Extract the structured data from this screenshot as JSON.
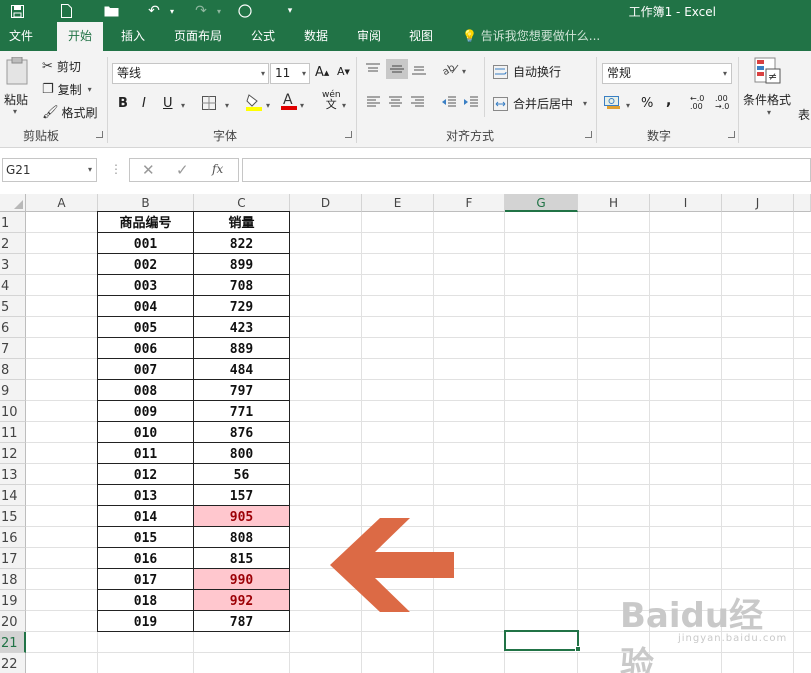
{
  "window": {
    "title": "工作簿1 - Excel"
  },
  "tabs": [
    "文件",
    "开始",
    "插入",
    "页面布局",
    "公式",
    "数据",
    "审阅",
    "视图"
  ],
  "tell_me": "告诉我您想要做什么...",
  "ribbon": {
    "clipboard": {
      "paste": "粘贴",
      "cut": "剪切",
      "copy": "复制",
      "format_painter": "格式刷",
      "label": "剪贴板"
    },
    "font": {
      "name": "等线",
      "size": "11",
      "label": "字体",
      "bold": "B",
      "italic": "I",
      "underline": "U",
      "phonetic": "wén"
    },
    "alignment": {
      "wrap_text": "自动换行",
      "merge_center": "合并后居中",
      "label": "对齐方式"
    },
    "number": {
      "format": "常规",
      "label": "数字",
      "percent": "%",
      "comma": ",",
      "inc_decimal": "←.0 .00",
      "dec_decimal": ".00 →.0"
    },
    "styles": {
      "conditional_formatting": "条件格式",
      "table_cut": "表"
    }
  },
  "formula_bar": {
    "name_box": "G21",
    "fx": "fx",
    "value": ""
  },
  "sheet": {
    "columns": [
      "A",
      "B",
      "C",
      "D",
      "E",
      "F",
      "G",
      "H",
      "I",
      "J"
    ],
    "selected_column": "G",
    "rows": [
      "1",
      "2",
      "3",
      "4",
      "5",
      "6",
      "7",
      "8",
      "9",
      "10",
      "11",
      "12",
      "13",
      "14",
      "15",
      "16",
      "17",
      "18",
      "19",
      "20",
      "21",
      "22"
    ],
    "selected_row": "21",
    "selected_cell": "G21",
    "headers": [
      "商品编号",
      "销量"
    ],
    "data": [
      [
        "001",
        "822"
      ],
      [
        "002",
        "899"
      ],
      [
        "003",
        "708"
      ],
      [
        "004",
        "729"
      ],
      [
        "005",
        "423"
      ],
      [
        "006",
        "889"
      ],
      [
        "007",
        "484"
      ],
      [
        "008",
        "797"
      ],
      [
        "009",
        "771"
      ],
      [
        "010",
        "876"
      ],
      [
        "011",
        "800"
      ],
      [
        "012",
        "56"
      ],
      [
        "013",
        "157"
      ],
      [
        "014",
        "905"
      ],
      [
        "015",
        "808"
      ],
      [
        "016",
        "815"
      ],
      [
        "017",
        "990"
      ],
      [
        "018",
        "992"
      ],
      [
        "019",
        "787"
      ]
    ],
    "highlighted": [
      "905",
      "990",
      "992"
    ],
    "highlight_fill": "#ffc7ce",
    "highlight_text": "#9c0006"
  },
  "annotation": {
    "arrow_color": "#dc6a45"
  },
  "watermark": {
    "text": "Baidu经验",
    "sub": "jingyan.baidu.com"
  },
  "colors": {
    "brand": "#217346"
  }
}
